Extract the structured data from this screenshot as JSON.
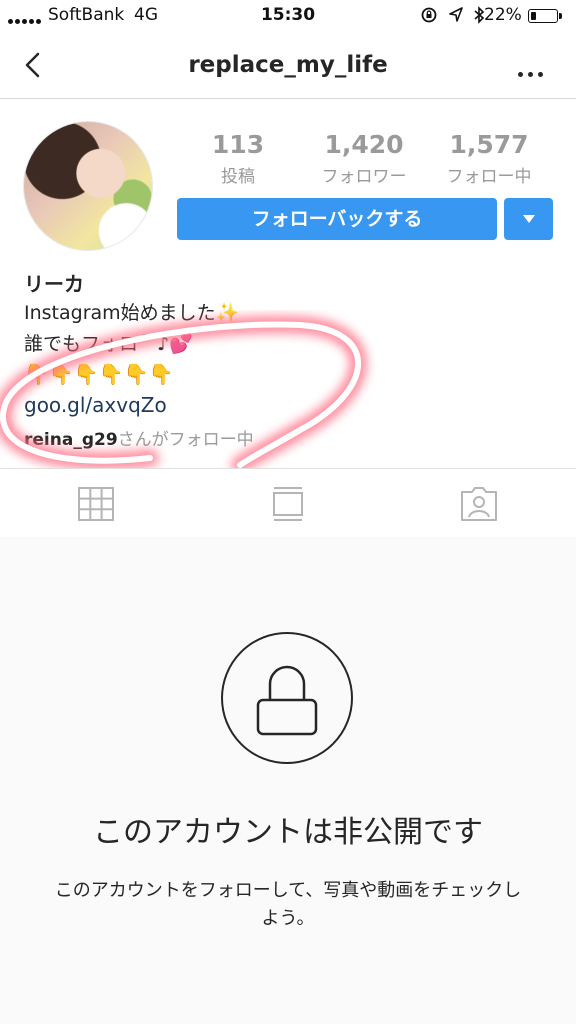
{
  "status_bar": {
    "carrier": "SoftBank",
    "network": "4G",
    "time": "15:30",
    "icons": [
      "lock-rotation-icon",
      "location-arrow-icon",
      "bluetooth-icon"
    ],
    "battery": "22%",
    "battery_level": 0.22
  },
  "nav": {
    "title": "replace_my_life",
    "back_icon": "chevron-left-icon",
    "more_icon": "more-dots-icon"
  },
  "profile": {
    "stats": [
      {
        "value": "113",
        "label": "投稿"
      },
      {
        "value": "1,420",
        "label": "フォロワー"
      },
      {
        "value": "1,577",
        "label": "フォロー中"
      }
    ],
    "follow_button": "フォローバックする",
    "dropdown_icon": "caret-down-icon",
    "name": "リーカ",
    "bio_lines": [
      "Instagram始めました✨",
      "誰でもフォロ⌒♪💕"
    ],
    "emoji_line": "👇👇👇👇👇👇",
    "link": "goo.gl/axvqZo",
    "mutual_user": "reina_g29",
    "mutual_suffix": "さんがフォロー中"
  },
  "tabs": [
    "grid-icon",
    "feed-icon",
    "tagged-icon"
  ],
  "private": {
    "lock_icon": "lock-icon",
    "title": "このアカウントは非公開です",
    "description": "このアカウントをフォローして、写真や動画をチェックしよう。"
  },
  "colors": {
    "accent": "#3897f0",
    "text": "#262626",
    "muted": "#9a9a9a",
    "scribble": "#ff6b81"
  }
}
